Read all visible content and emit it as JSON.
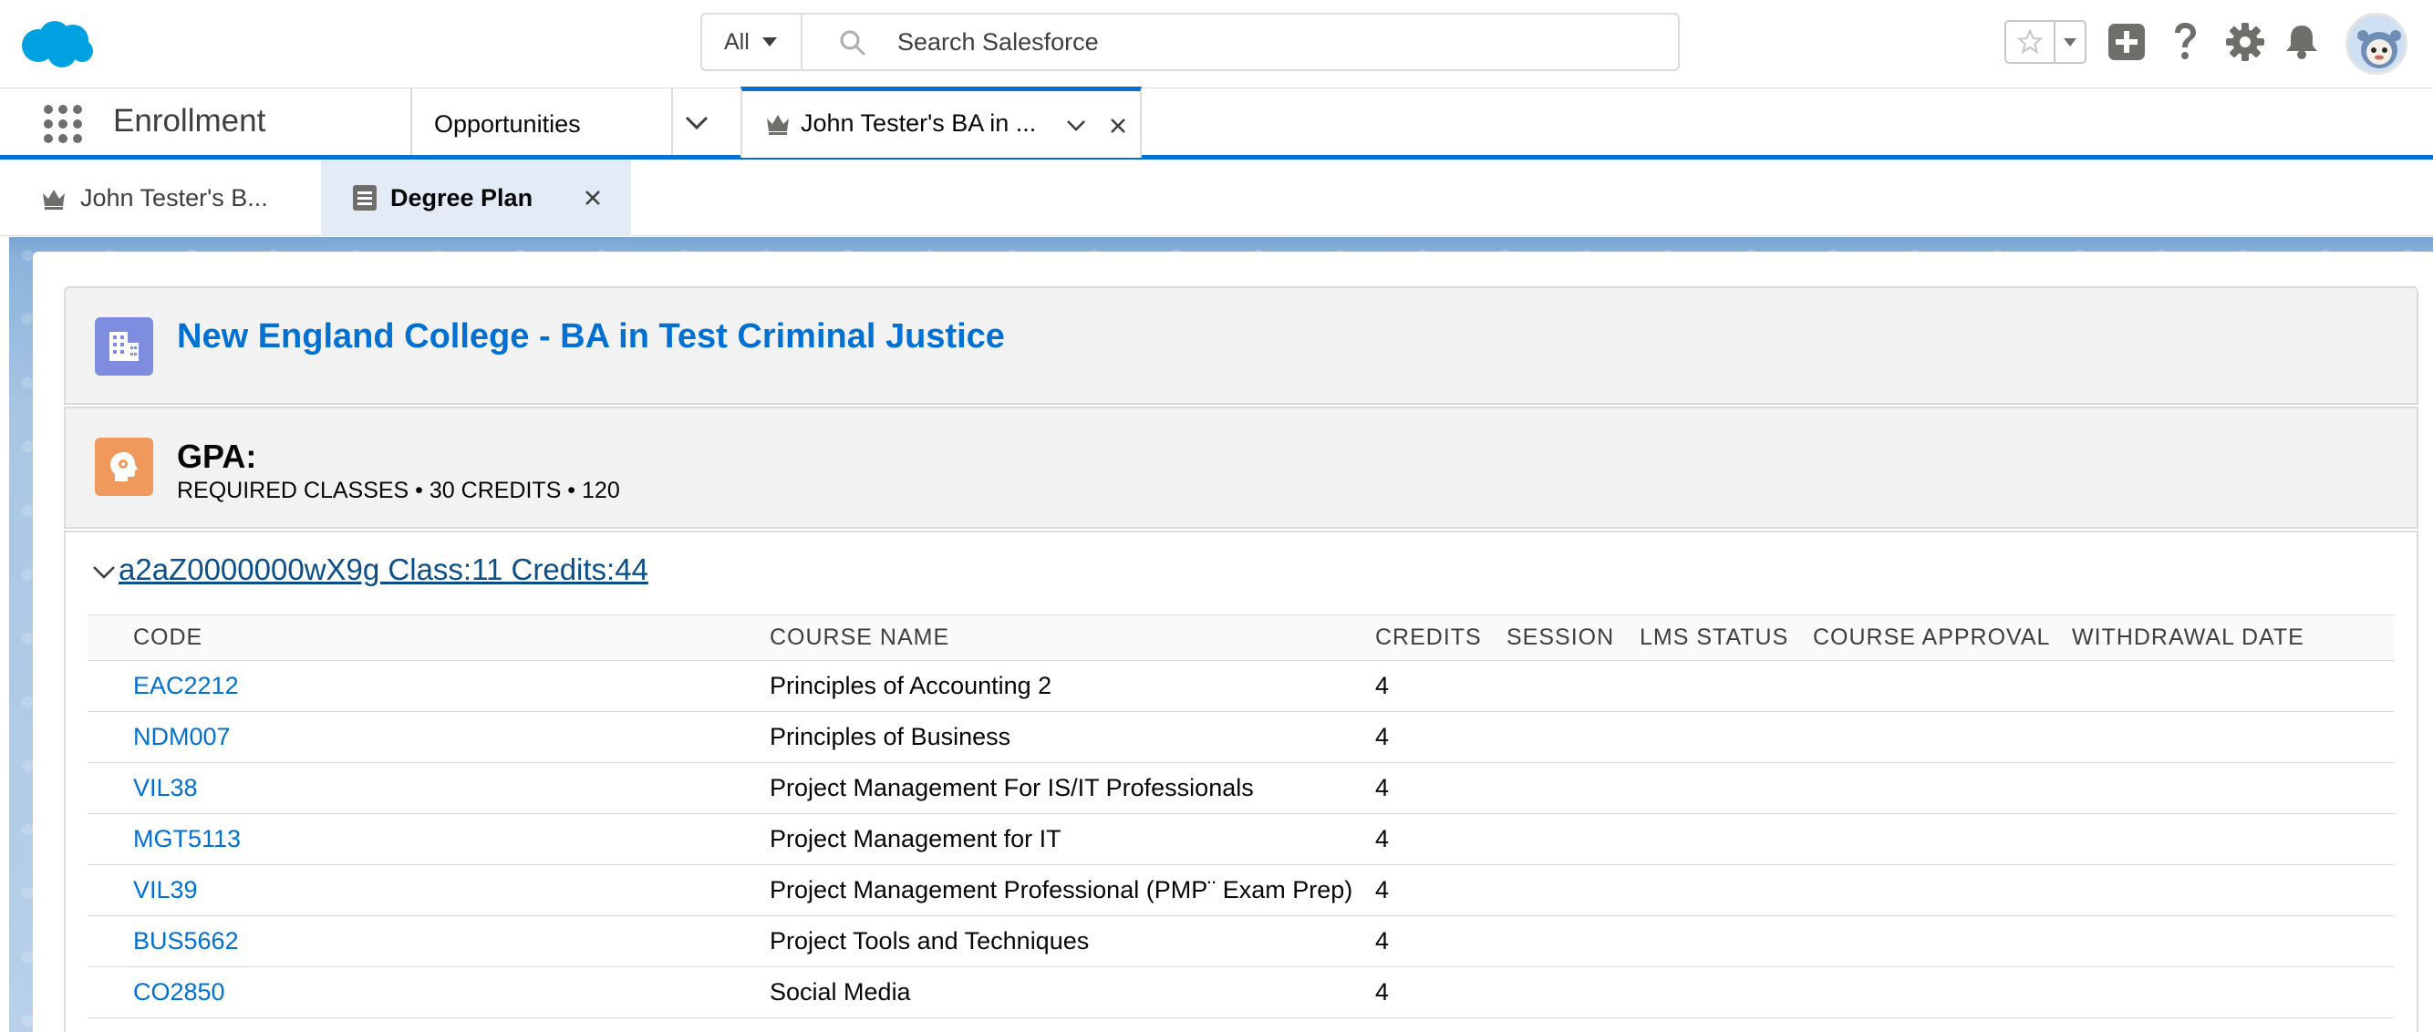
{
  "header": {
    "search_scope": "All",
    "search_placeholder": "Search Salesforce",
    "icons": [
      "salesforce-cloud-logo",
      "star-icon",
      "chevron-down-icon",
      "plus-icon",
      "question-icon",
      "gear-icon",
      "bell-icon",
      "avatar"
    ]
  },
  "nav": {
    "app_name": "Enrollment",
    "items": [
      "Opportunities"
    ],
    "workspace_tab": "John Tester's BA in ..."
  },
  "subtabs": [
    {
      "label": "John Tester's B..."
    },
    {
      "label": "Degree Plan"
    }
  ],
  "record": {
    "title": "New England College - BA in Test Criminal Justice"
  },
  "gpa": {
    "title": "GPA:",
    "subtitle": "REQUIRED CLASSES • 30 CREDITS • 120"
  },
  "group": {
    "label": "a2aZ0000000wX9g Class:11 Credits:44"
  },
  "table": {
    "headers": [
      "CODE",
      "COURSE NAME",
      "CREDITS",
      "SESSION",
      "LMS STATUS",
      "COURSE APPROVAL",
      "WITHDRAWAL DATE"
    ],
    "rows": [
      {
        "code": "EAC2212",
        "name": "Principles of Accounting 2",
        "credits": "4"
      },
      {
        "code": "NDM007",
        "name": "Principles of Business",
        "credits": "4"
      },
      {
        "code": "VIL38",
        "name": "Project Management For IS/IT Professionals",
        "credits": "4"
      },
      {
        "code": "MGT5113",
        "name": "Project Management for IT",
        "credits": "4"
      },
      {
        "code": "VIL39",
        "name": "Project Management Professional (PMP¨ Exam Prep)",
        "credits": "4"
      },
      {
        "code": "BUS5662",
        "name": "Project Tools and Techniques",
        "credits": "4"
      },
      {
        "code": "CO2850",
        "name": "Social Media",
        "credits": "4"
      }
    ]
  },
  "colors": {
    "brand_blue": "#0070d2",
    "link_dark": "#0b4f8a",
    "record_icon": "#7f8de1",
    "gpa_icon": "#ef9a5c",
    "subtab_active": "#e3ecf6"
  }
}
